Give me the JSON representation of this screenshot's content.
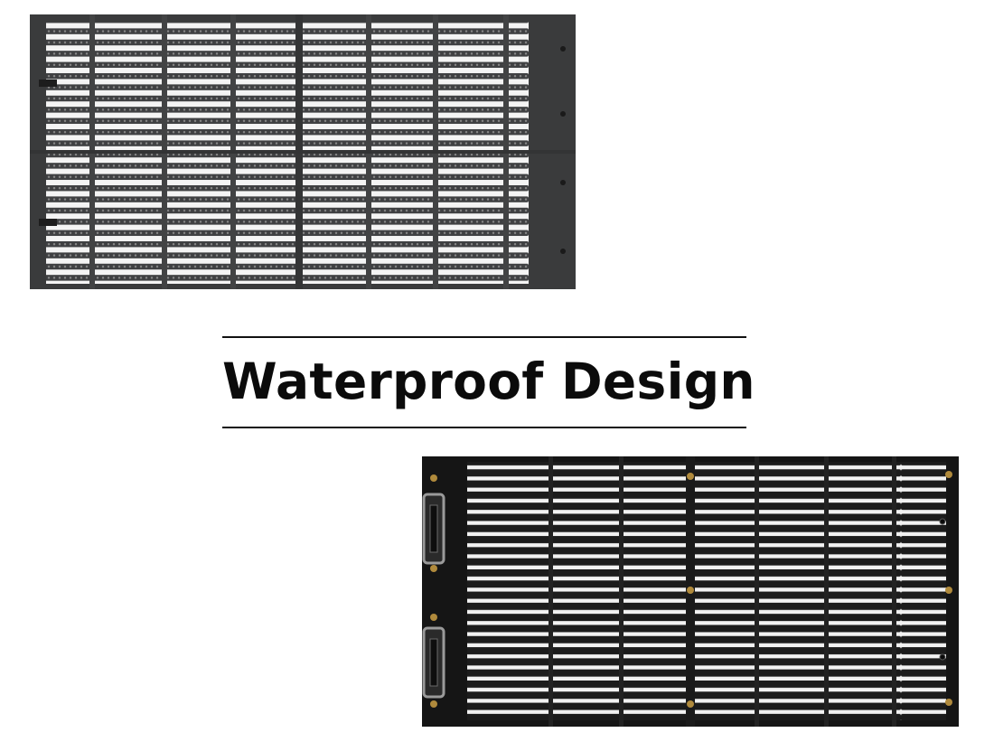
{
  "heading": {
    "text": "Waterproof Design"
  },
  "colors": {
    "background": "#ffffff",
    "heading": "#0b0b0b",
    "rule": "#111111",
    "front_panel": "#3a3b3c",
    "back_panel": "#151515",
    "screw": "#b08a3c"
  },
  "images": {
    "front_panel": "led-mesh-panel-front-photo",
    "back_panel": "led-mesh-panel-back-photo"
  }
}
